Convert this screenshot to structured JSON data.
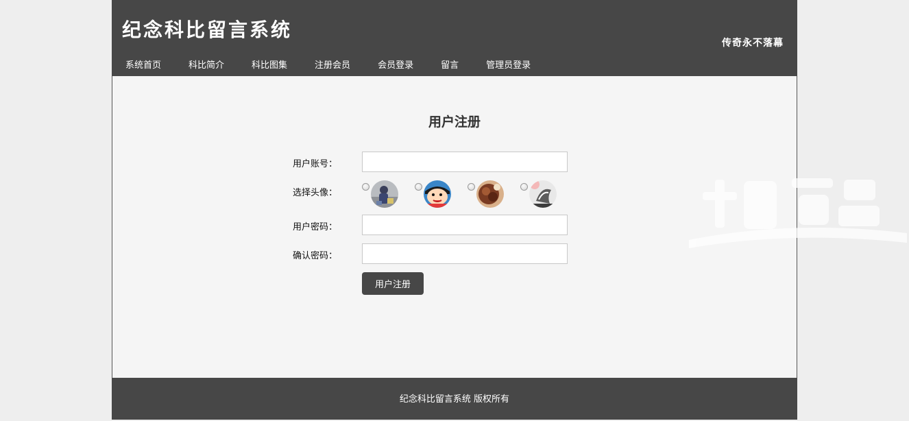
{
  "header": {
    "title": "纪念科比留言系统",
    "slogan": "传奇永不落幕"
  },
  "nav": {
    "items": [
      {
        "label": "系统首页"
      },
      {
        "label": "科比简介"
      },
      {
        "label": "科比图集"
      },
      {
        "label": "注册会员"
      },
      {
        "label": "会员登录"
      },
      {
        "label": "留言"
      },
      {
        "label": "管理员登录"
      }
    ]
  },
  "form": {
    "title": "用户注册",
    "account_label": "用户账号：",
    "account_value": "",
    "avatar_label": "选择头像：",
    "password_label": "用户密码：",
    "password_value": "",
    "confirm_label": "确认密码：",
    "confirm_value": "",
    "submit_label": "用户注册"
  },
  "footer": {
    "text": "纪念科比留言系统 版权所有"
  },
  "colors": {
    "header_bg": "#474747",
    "content_bg": "#f5f5f5",
    "page_bg": "#eeeeee",
    "button_bg": "#474747"
  }
}
